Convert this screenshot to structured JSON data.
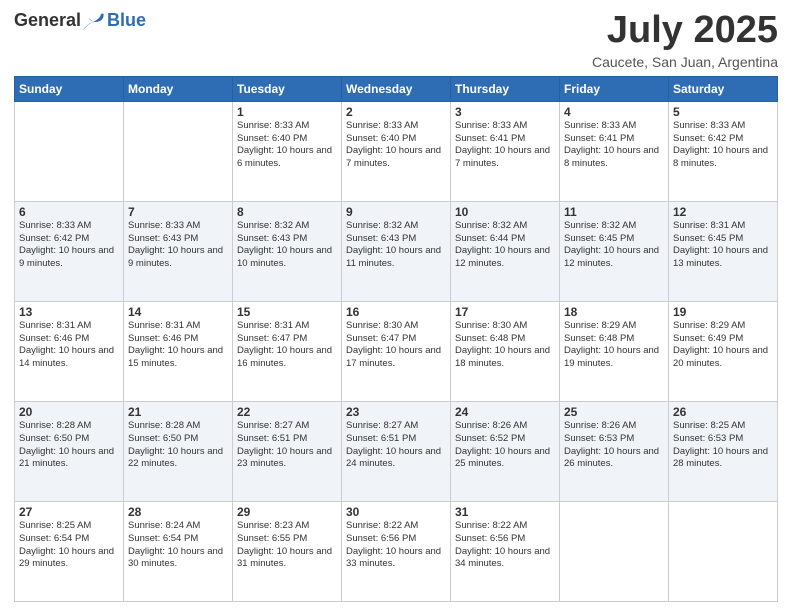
{
  "header": {
    "logo_general": "General",
    "logo_blue": "Blue",
    "month_title": "July 2025",
    "subtitle": "Caucete, San Juan, Argentina"
  },
  "weekdays": [
    "Sunday",
    "Monday",
    "Tuesday",
    "Wednesday",
    "Thursday",
    "Friday",
    "Saturday"
  ],
  "weeks": [
    [
      {
        "day": "",
        "text": ""
      },
      {
        "day": "",
        "text": ""
      },
      {
        "day": "1",
        "text": "Sunrise: 8:33 AM\nSunset: 6:40 PM\nDaylight: 10 hours and 6 minutes."
      },
      {
        "day": "2",
        "text": "Sunrise: 8:33 AM\nSunset: 6:40 PM\nDaylight: 10 hours and 7 minutes."
      },
      {
        "day": "3",
        "text": "Sunrise: 8:33 AM\nSunset: 6:41 PM\nDaylight: 10 hours and 7 minutes."
      },
      {
        "day": "4",
        "text": "Sunrise: 8:33 AM\nSunset: 6:41 PM\nDaylight: 10 hours and 8 minutes."
      },
      {
        "day": "5",
        "text": "Sunrise: 8:33 AM\nSunset: 6:42 PM\nDaylight: 10 hours and 8 minutes."
      }
    ],
    [
      {
        "day": "6",
        "text": "Sunrise: 8:33 AM\nSunset: 6:42 PM\nDaylight: 10 hours and 9 minutes."
      },
      {
        "day": "7",
        "text": "Sunrise: 8:33 AM\nSunset: 6:43 PM\nDaylight: 10 hours and 9 minutes."
      },
      {
        "day": "8",
        "text": "Sunrise: 8:32 AM\nSunset: 6:43 PM\nDaylight: 10 hours and 10 minutes."
      },
      {
        "day": "9",
        "text": "Sunrise: 8:32 AM\nSunset: 6:43 PM\nDaylight: 10 hours and 11 minutes."
      },
      {
        "day": "10",
        "text": "Sunrise: 8:32 AM\nSunset: 6:44 PM\nDaylight: 10 hours and 12 minutes."
      },
      {
        "day": "11",
        "text": "Sunrise: 8:32 AM\nSunset: 6:45 PM\nDaylight: 10 hours and 12 minutes."
      },
      {
        "day": "12",
        "text": "Sunrise: 8:31 AM\nSunset: 6:45 PM\nDaylight: 10 hours and 13 minutes."
      }
    ],
    [
      {
        "day": "13",
        "text": "Sunrise: 8:31 AM\nSunset: 6:46 PM\nDaylight: 10 hours and 14 minutes."
      },
      {
        "day": "14",
        "text": "Sunrise: 8:31 AM\nSunset: 6:46 PM\nDaylight: 10 hours and 15 minutes."
      },
      {
        "day": "15",
        "text": "Sunrise: 8:31 AM\nSunset: 6:47 PM\nDaylight: 10 hours and 16 minutes."
      },
      {
        "day": "16",
        "text": "Sunrise: 8:30 AM\nSunset: 6:47 PM\nDaylight: 10 hours and 17 minutes."
      },
      {
        "day": "17",
        "text": "Sunrise: 8:30 AM\nSunset: 6:48 PM\nDaylight: 10 hours and 18 minutes."
      },
      {
        "day": "18",
        "text": "Sunrise: 8:29 AM\nSunset: 6:48 PM\nDaylight: 10 hours and 19 minutes."
      },
      {
        "day": "19",
        "text": "Sunrise: 8:29 AM\nSunset: 6:49 PM\nDaylight: 10 hours and 20 minutes."
      }
    ],
    [
      {
        "day": "20",
        "text": "Sunrise: 8:28 AM\nSunset: 6:50 PM\nDaylight: 10 hours and 21 minutes."
      },
      {
        "day": "21",
        "text": "Sunrise: 8:28 AM\nSunset: 6:50 PM\nDaylight: 10 hours and 22 minutes."
      },
      {
        "day": "22",
        "text": "Sunrise: 8:27 AM\nSunset: 6:51 PM\nDaylight: 10 hours and 23 minutes."
      },
      {
        "day": "23",
        "text": "Sunrise: 8:27 AM\nSunset: 6:51 PM\nDaylight: 10 hours and 24 minutes."
      },
      {
        "day": "24",
        "text": "Sunrise: 8:26 AM\nSunset: 6:52 PM\nDaylight: 10 hours and 25 minutes."
      },
      {
        "day": "25",
        "text": "Sunrise: 8:26 AM\nSunset: 6:53 PM\nDaylight: 10 hours and 26 minutes."
      },
      {
        "day": "26",
        "text": "Sunrise: 8:25 AM\nSunset: 6:53 PM\nDaylight: 10 hours and 28 minutes."
      }
    ],
    [
      {
        "day": "27",
        "text": "Sunrise: 8:25 AM\nSunset: 6:54 PM\nDaylight: 10 hours and 29 minutes."
      },
      {
        "day": "28",
        "text": "Sunrise: 8:24 AM\nSunset: 6:54 PM\nDaylight: 10 hours and 30 minutes."
      },
      {
        "day": "29",
        "text": "Sunrise: 8:23 AM\nSunset: 6:55 PM\nDaylight: 10 hours and 31 minutes."
      },
      {
        "day": "30",
        "text": "Sunrise: 8:22 AM\nSunset: 6:56 PM\nDaylight: 10 hours and 33 minutes."
      },
      {
        "day": "31",
        "text": "Sunrise: 8:22 AM\nSunset: 6:56 PM\nDaylight: 10 hours and 34 minutes."
      },
      {
        "day": "",
        "text": ""
      },
      {
        "day": "",
        "text": ""
      }
    ]
  ]
}
